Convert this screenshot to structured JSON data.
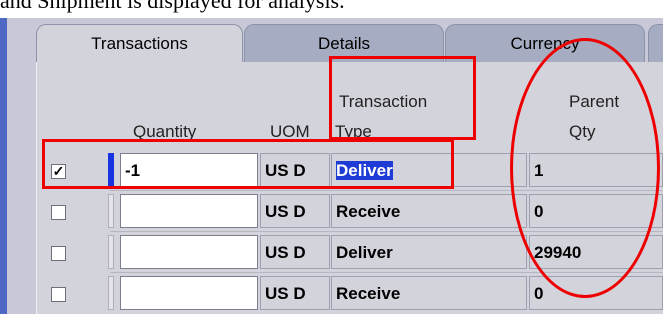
{
  "caption": "and Shipment is displayed for analysis.",
  "tabs": [
    {
      "label": "Transactions",
      "active": true
    },
    {
      "label": "Details",
      "active": false
    },
    {
      "label": "Currency",
      "active": false
    }
  ],
  "columns": {
    "quantity": "Quantity",
    "uom": "UOM",
    "transaction_type_line1": "Transaction",
    "transaction_type_line2": "Type",
    "parent_qty_line1": "Parent",
    "parent_qty_line2": "Qty"
  },
  "rows": [
    {
      "checked": true,
      "check_glyph": "✓",
      "quantity": "-1",
      "uom": "US D",
      "transaction_type": "Deliver",
      "parent_qty": "1"
    },
    {
      "checked": false,
      "check_glyph": "",
      "quantity": "",
      "uom": "US D",
      "transaction_type": "Receive",
      "parent_qty": "0"
    },
    {
      "checked": false,
      "check_glyph": "",
      "quantity": "",
      "uom": "US D",
      "transaction_type": "Deliver",
      "parent_qty": "29940"
    },
    {
      "checked": false,
      "check_glyph": "",
      "quantity": "",
      "uom": "US D",
      "transaction_type": "Receive",
      "parent_qty": "0"
    }
  ],
  "colors": {
    "annotation": "#ee0000",
    "selection": "#1f3bd6",
    "border_accent": "#4f68c4"
  }
}
